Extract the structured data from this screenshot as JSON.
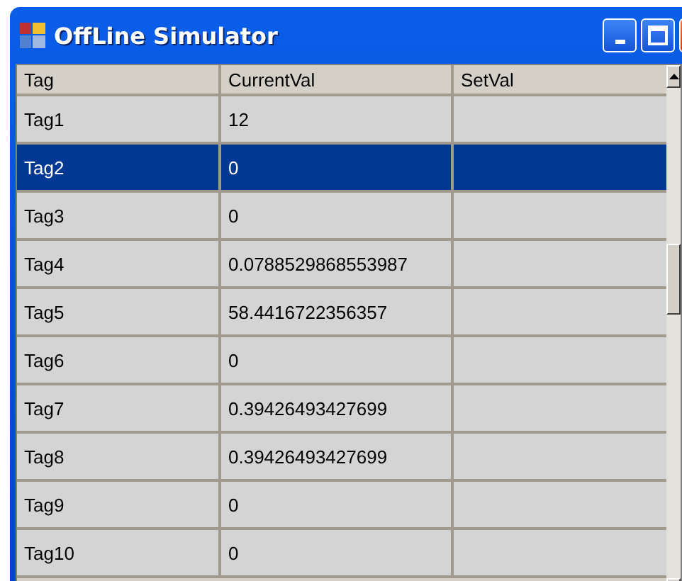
{
  "window": {
    "title": "OffLine Simulator"
  },
  "table": {
    "columns": [
      "Tag",
      "CurrentVal",
      "SetVal"
    ],
    "rows": [
      {
        "cells": [
          "Tag1",
          "12",
          ""
        ],
        "selected": false
      },
      {
        "cells": [
          "Tag2",
          "0",
          ""
        ],
        "selected": true
      },
      {
        "cells": [
          "Tag3",
          "0",
          ""
        ],
        "selected": false
      },
      {
        "cells": [
          "Tag4",
          "0.0788529868553987",
          ""
        ],
        "selected": false
      },
      {
        "cells": [
          "Tag5",
          "58.4416722356357",
          ""
        ],
        "selected": false
      },
      {
        "cells": [
          "Tag6",
          "0",
          ""
        ],
        "selected": false
      },
      {
        "cells": [
          "Tag7",
          "0.39426493427699",
          ""
        ],
        "selected": false
      },
      {
        "cells": [
          "Tag8",
          "0.39426493427699",
          ""
        ],
        "selected": false
      },
      {
        "cells": [
          "Tag9",
          "0",
          ""
        ],
        "selected": false
      },
      {
        "cells": [
          "Tag10",
          "0",
          ""
        ],
        "selected": false
      }
    ]
  }
}
